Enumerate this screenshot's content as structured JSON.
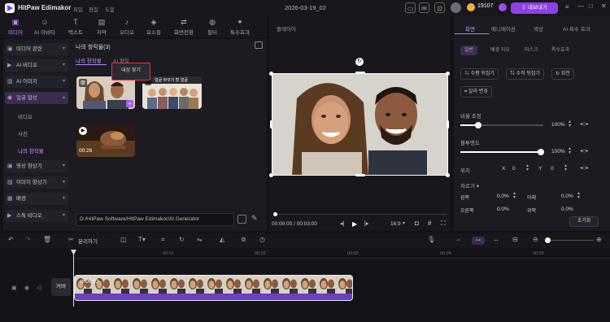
{
  "titlebar": {
    "app_name": "HitPaw Edimakor",
    "menu": [
      "파일",
      "편집",
      "도움"
    ],
    "date": "2026-03-19_02",
    "coins": "19107",
    "upgrade_label": "내보내기"
  },
  "toolbar": {
    "items": [
      {
        "label": "미디어",
        "icon": "media-icon"
      },
      {
        "label": "AI 아바타",
        "icon": "avatar-icon"
      },
      {
        "label": "텍스트",
        "icon": "text-icon"
      },
      {
        "label": "자막",
        "icon": "subtitle-icon"
      },
      {
        "label": "오디오",
        "icon": "audio-icon"
      },
      {
        "label": "요소들",
        "icon": "elements-icon"
      },
      {
        "label": "화면전환",
        "icon": "transition-icon"
      },
      {
        "label": "필터",
        "icon": "filter-icon"
      },
      {
        "label": "특수효과",
        "icon": "effects-icon"
      }
    ]
  },
  "sidebar": {
    "items": [
      {
        "label": "미디어 관련"
      },
      {
        "label": "AI 비디오"
      },
      {
        "label": "AI 이미지"
      },
      {
        "label": "얼굴 합성"
      }
    ],
    "subitems": [
      "비디오",
      "사진",
      "나의 창작물"
    ],
    "items2": [
      {
        "label": "영상 향상기"
      },
      {
        "label": "이미지 향상기"
      },
      {
        "label": "배경"
      },
      {
        "label": "스톡 비디오"
      }
    ]
  },
  "media": {
    "title": "나의 창작물(3)",
    "tab_mine": "나의 창작물",
    "tab_ai": "AI 파일",
    "tooltip": "대상 찾기",
    "clip_duration": "00:26",
    "path": "D:/HitPaw Software/HitPaw Edimakor/AI Generator",
    "thumb2_caption": "얼굴 바꾸기 할 얼굴"
  },
  "player": {
    "title": "플레이어",
    "timecode": "00:00:00 / 00:03:00",
    "ratio": "16:9"
  },
  "rpanel": {
    "tabs": [
      "화면",
      "애니메이션",
      "색상",
      "AI 특수 효과"
    ],
    "subtabs": [
      "일반",
      "배경 지우",
      "마스크",
      "특수효과"
    ],
    "flip_h": "수평 뒤집기",
    "flip_v": "수직 뒤집기",
    "rotate": "회전",
    "crop": "잘라 변경",
    "scale_label": "비율 조정",
    "scale_value": "100%",
    "opacity_label": "불투명도",
    "opacity_value": "100%",
    "position_label": "위치",
    "pos_x_label": "X",
    "pos_x": "0",
    "pos_y_label": "Y",
    "pos_y": "0",
    "crop_label": "자르기",
    "crop_vals": [
      "0.0%",
      "0.0%",
      "0.0%",
      "0.0%"
    ],
    "crop_names": [
      "왼쪽",
      "아래",
      "오른쪽",
      "위쪽"
    ],
    "reset": "초기화"
  },
  "timeline": {
    "undo_label": "분리하기",
    "ticks": [
      "00:01",
      "00:02",
      "00:03",
      "00:04",
      "00:05"
    ],
    "cover_label": "커버",
    "clip_time": "00:03"
  }
}
